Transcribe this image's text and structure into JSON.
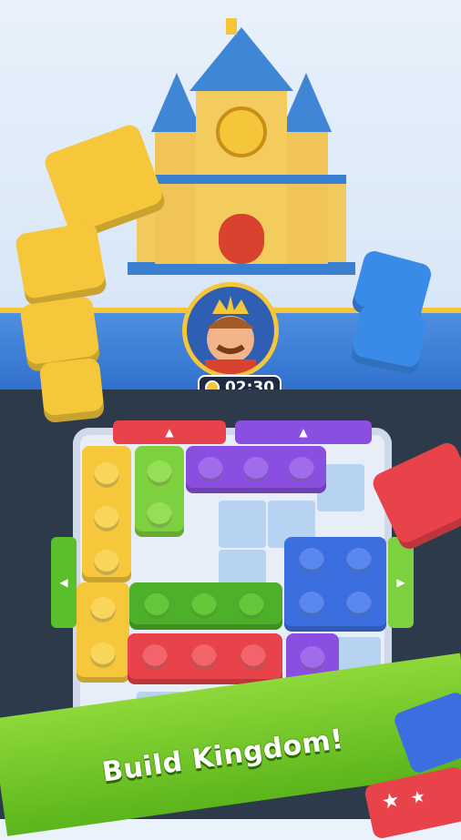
{
  "hud": {
    "timer": "02:30",
    "timer_icon": "clock-icon"
  },
  "caption": "Build Kingdom!",
  "colors": {
    "yellow": "#f6c73b",
    "green": "#7dd03e",
    "purple": "#8a4fe0",
    "red": "#e8424a",
    "blue": "#3b6fe0",
    "board_cell": "#b8d3f2"
  },
  "icons": [
    "castle-icon",
    "king-avatar-icon",
    "up-arrow-icon",
    "left-arrow-icon",
    "right-arrow-icon",
    "star-icon"
  ]
}
